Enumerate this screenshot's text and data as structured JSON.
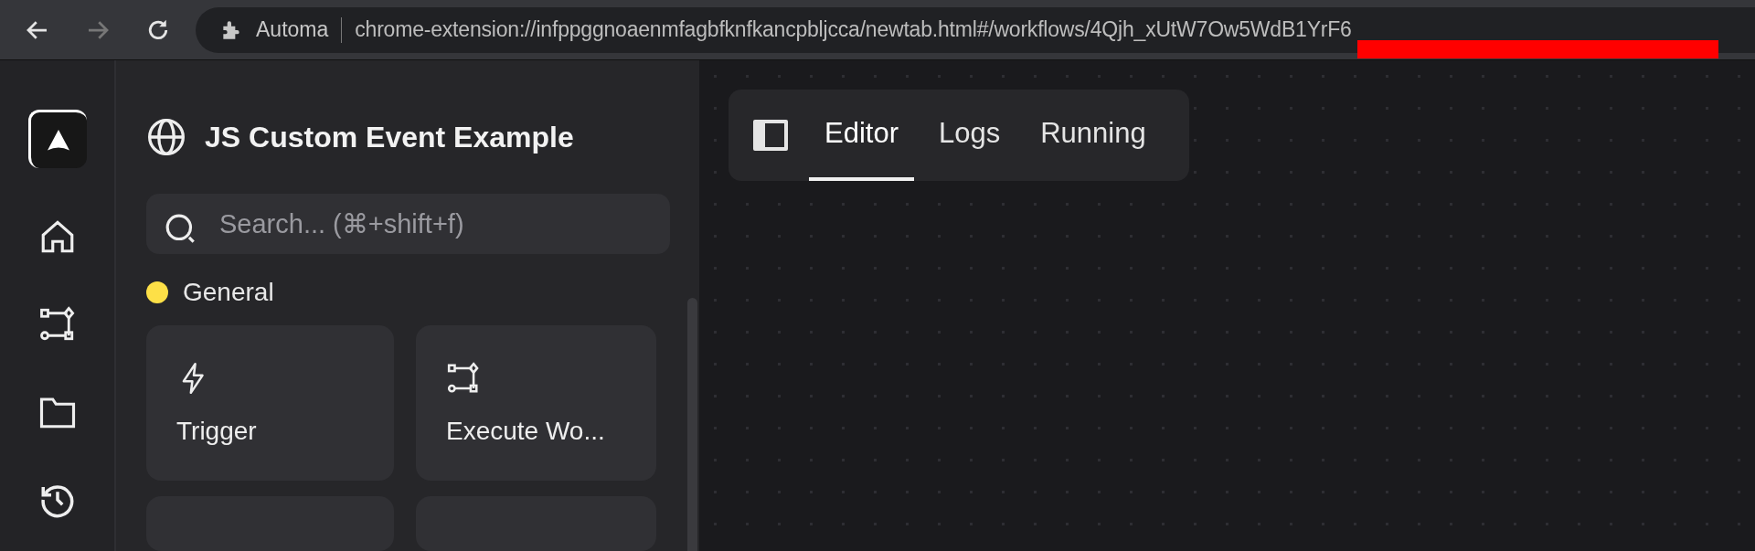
{
  "browser": {
    "extension_name": "Automa",
    "url": "chrome-extension://infppggnoaenmfagbfknfkancpbljcca/newtab.html#/workflows/4Qjh_xUtW7Ow5WdB1YrF6"
  },
  "workflow": {
    "title": "JS Custom Event Example"
  },
  "search": {
    "placeholder": "Search... (⌘+shift+f)"
  },
  "category": {
    "name": "General",
    "color": "#fde047"
  },
  "blocks": [
    {
      "kind": "trigger",
      "label": "Trigger"
    },
    {
      "kind": "workflow",
      "label": "Execute Wo..."
    }
  ],
  "tabs": [
    {
      "label": "Editor",
      "selected": true
    },
    {
      "label": "Logs",
      "selected": false
    },
    {
      "label": "Running",
      "selected": false
    }
  ]
}
